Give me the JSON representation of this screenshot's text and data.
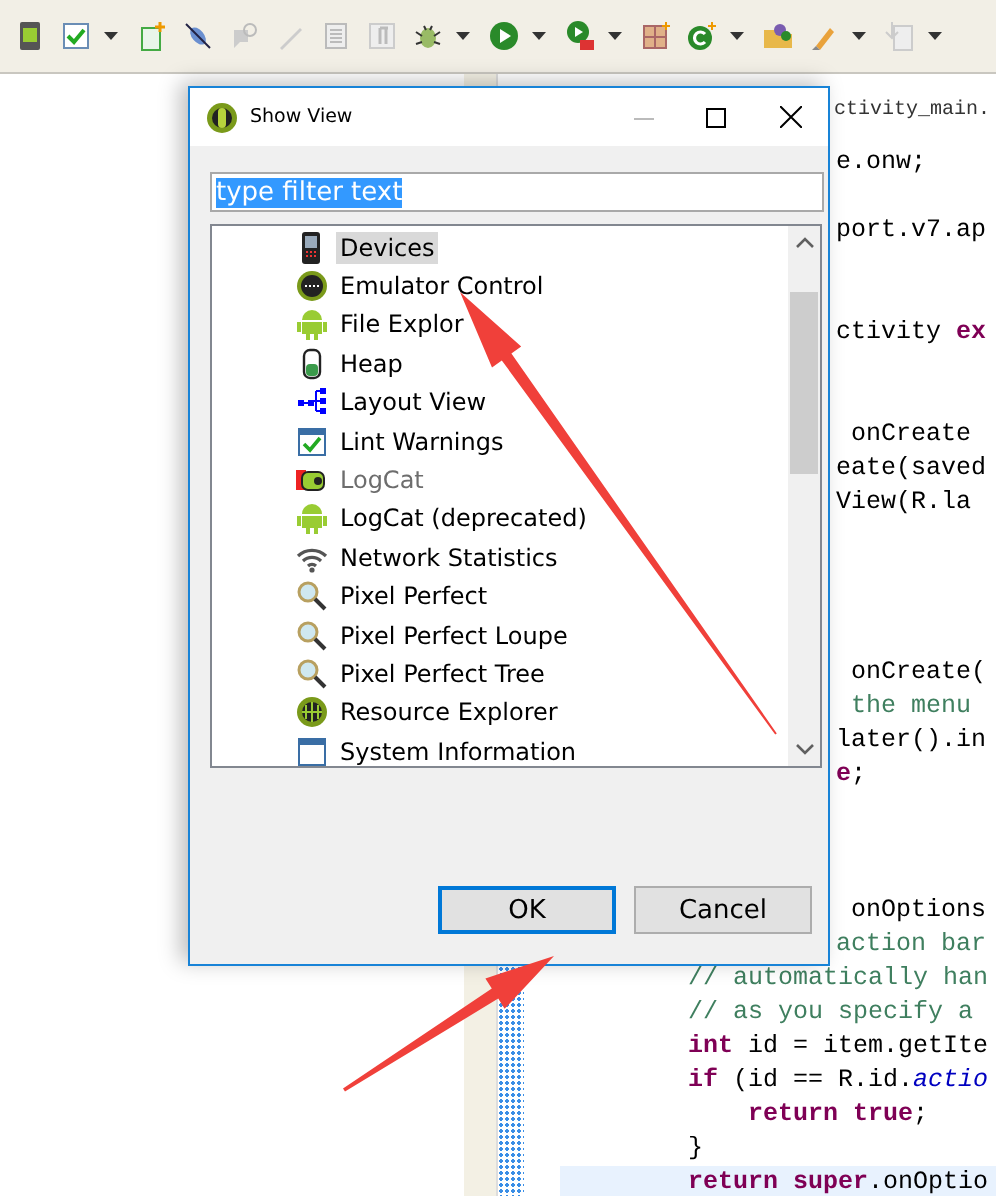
{
  "editor": {
    "tab": {
      "label": "ctivity_main."
    },
    "lines": [
      {
        "current": false,
        "segments": [
          {
            "kind": "plain",
            "text": "e.onw;"
          }
        ]
      },
      {
        "current": false,
        "segments": [
          {
            "kind": "plain",
            "text": "port.v7.ap"
          }
        ]
      },
      {
        "current": false,
        "segments": [
          {
            "kind": "plain",
            "text": "ctivity "
          },
          {
            "kind": "keyword",
            "text": "ex"
          }
        ]
      },
      {
        "current": false,
        "segments": [
          {
            "kind": "plain",
            "text": " onCreate"
          }
        ]
      },
      {
        "current": false,
        "segments": [
          {
            "kind": "plain",
            "text": "eate(saved"
          }
        ]
      },
      {
        "current": false,
        "segments": [
          {
            "kind": "plain",
            "text": "View(R.la"
          }
        ]
      },
      {
        "current": false,
        "segments": [
          {
            "kind": "plain",
            "text": " onCreate("
          }
        ]
      },
      {
        "current": false,
        "segments": [
          {
            "kind": "comment",
            "text": " the menu"
          }
        ]
      },
      {
        "current": false,
        "segments": [
          {
            "kind": "plain",
            "text": "later().in"
          }
        ]
      },
      {
        "current": false,
        "segments": [
          {
            "kind": "keyword",
            "text": "e"
          },
          {
            "kind": "plain",
            "text": ";"
          }
        ]
      },
      {
        "current": false,
        "segments": [
          {
            "kind": "plain",
            "text": " onOptions"
          }
        ]
      },
      {
        "current": false,
        "segments": [
          {
            "kind": "comment",
            "text": "action bar"
          }
        ]
      },
      {
        "current": false,
        "segments": [
          {
            "kind": "comment",
            "text": "// automatically han"
          }
        ]
      },
      {
        "current": false,
        "segments": [
          {
            "kind": "comment",
            "text": "// as you specify a"
          }
        ]
      },
      {
        "current": false,
        "segments": [
          {
            "kind": "keyword",
            "text": "int"
          },
          {
            "kind": "plain",
            "text": " id = item.getIte"
          }
        ]
      },
      {
        "current": false,
        "segments": [
          {
            "kind": "keyword",
            "text": "if"
          },
          {
            "kind": "plain",
            "text": " (id == R.id."
          },
          {
            "kind": "field",
            "text": "actio"
          }
        ]
      },
      {
        "current": false,
        "segments": [
          {
            "kind": "keyword",
            "text": "    return "
          },
          {
            "kind": "keyword",
            "text": "true"
          },
          {
            "kind": "plain",
            "text": ";"
          }
        ]
      },
      {
        "current": false,
        "segments": [
          {
            "kind": "plain",
            "text": "}"
          }
        ]
      },
      {
        "current": true,
        "segments": [
          {
            "kind": "keyword",
            "text": "return "
          },
          {
            "kind": "keyword",
            "text": "super"
          },
          {
            "kind": "plain",
            "text": ".onOptio"
          }
        ]
      }
    ]
  },
  "dialog": {
    "title": "Show View",
    "filter": {
      "value": "type filter text",
      "text_selected": true
    },
    "views": [
      {
        "label": "Devices",
        "selected": true,
        "disabled": false
      },
      {
        "label": "Emulator Control",
        "selected": false,
        "disabled": false
      },
      {
        "label": "File Explor",
        "selected": false,
        "disabled": false
      },
      {
        "label": "Heap",
        "selected": false,
        "disabled": false
      },
      {
        "label": "Layout View",
        "selected": false,
        "disabled": false
      },
      {
        "label": "Lint Warnings",
        "selected": false,
        "disabled": false
      },
      {
        "label": "LogCat",
        "selected": false,
        "disabled": true
      },
      {
        "label": "LogCat (deprecated)",
        "selected": false,
        "disabled": false
      },
      {
        "label": "Network Statistics",
        "selected": false,
        "disabled": false
      },
      {
        "label": "Pixel Perfect",
        "selected": false,
        "disabled": false
      },
      {
        "label": "Pixel Perfect Loupe",
        "selected": false,
        "disabled": false
      },
      {
        "label": "Pixel Perfect Tree",
        "selected": false,
        "disabled": false
      },
      {
        "label": "Resource Explorer",
        "selected": false,
        "disabled": false
      },
      {
        "label": "System Information",
        "selected": false,
        "disabled": false
      }
    ],
    "buttons": [
      {
        "label": "OK",
        "default": true
      },
      {
        "label": "Cancel",
        "default": false
      }
    ]
  }
}
